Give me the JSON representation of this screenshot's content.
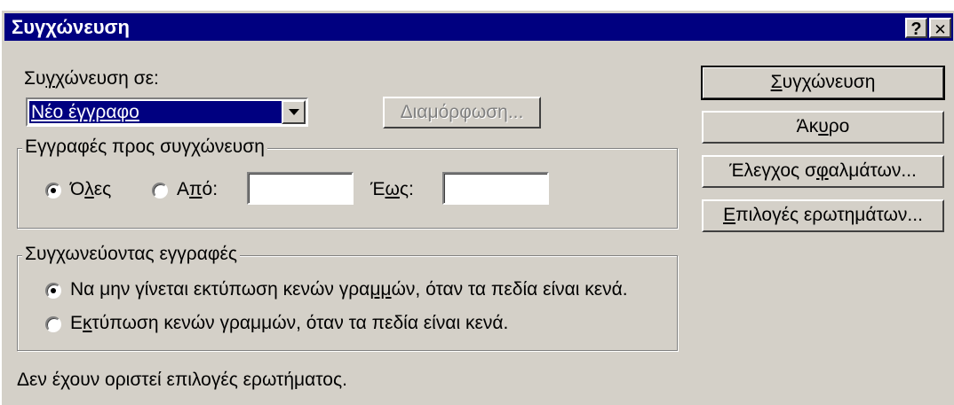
{
  "window": {
    "title": "Συγχώνευση",
    "help_label": "?",
    "close_label": "✕"
  },
  "merge_to": {
    "label_pre": "Συ",
    "label_u": "γ",
    "label_post": "χώνευση σε:",
    "selected": "Νέο έγγραφο",
    "setup_button": "Διαμόρφωση..."
  },
  "records_group": {
    "legend": "Εγγραφές προς συγχώνευση",
    "all_pre": "Ό",
    "all_u": "λ",
    "all_post": "ες",
    "all_checked": true,
    "from_pre": "Α",
    "from_u": "π",
    "from_post": "ό:",
    "from_value": "",
    "to_pre": "Έ",
    "to_u": "ω",
    "to_post": "ς:",
    "to_value": ""
  },
  "blank_group": {
    "legend": "Συγχωνεύοντας εγγραφές",
    "opt1_pre": "Να μην γίνεται εκτύπωση κενών γρα",
    "opt1_u": "μμ",
    "opt1_post": "ών, όταν τα πεδία είναι κενά.",
    "opt1_checked": true,
    "opt2_pre": "Ε",
    "opt2_u": "κ",
    "opt2_post": "τύπωση κενών γραμμών, όταν τα πεδία είναι κενά."
  },
  "status_text": "Δεν έχουν οριστεί επιλογές ερωτήματος.",
  "buttons": {
    "merge_u": "Σ",
    "merge_post": "υγχώνευση",
    "cancel_pre": "Άκ",
    "cancel_u": "υ",
    "cancel_post": "ρο",
    "check_pre": "Έλεγχος σ",
    "check_u": "φ",
    "check_post": "αλμάτων...",
    "query_u": "Ε",
    "query_post": "πιλογές ερωτημάτων..."
  }
}
